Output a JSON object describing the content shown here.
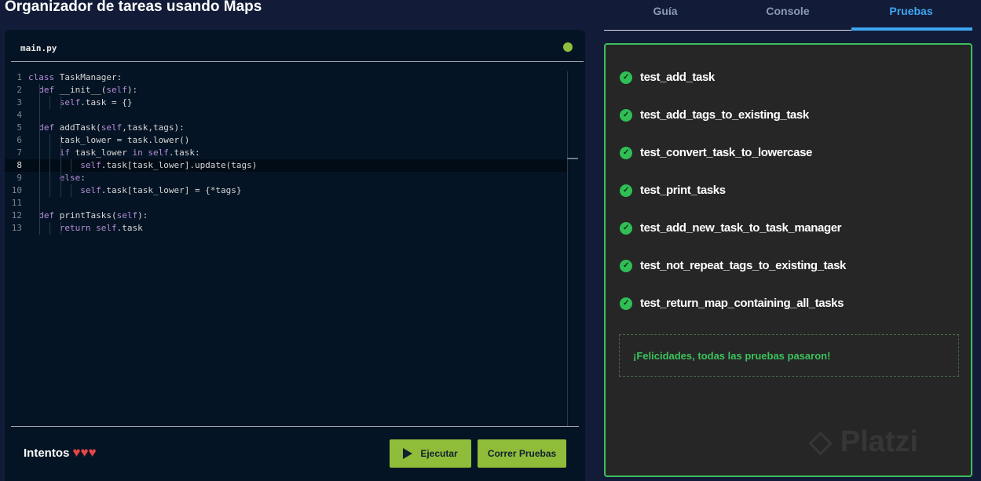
{
  "title": "Organizador de tareas usando Maps",
  "editor": {
    "filename": "main.py",
    "lines": [
      {
        "n": "1",
        "indent": 0,
        "tokens": [
          [
            "kw",
            "class "
          ],
          [
            "t",
            "TaskManager:"
          ]
        ]
      },
      {
        "n": "2",
        "indent": 1,
        "tokens": [
          [
            "kw",
            "def "
          ],
          [
            "t",
            "__init__("
          ],
          [
            "kw",
            "self"
          ],
          [
            "t",
            "):"
          ]
        ]
      },
      {
        "n": "3",
        "indent": 3,
        "tokens": [
          [
            "kw",
            "self"
          ],
          [
            "t",
            ".task = {}"
          ]
        ]
      },
      {
        "n": "4",
        "indent": 0,
        "tokens": []
      },
      {
        "n": "5",
        "indent": 1,
        "tokens": [
          [
            "kw",
            "def "
          ],
          [
            "t",
            "addTask("
          ],
          [
            "kw",
            "self"
          ],
          [
            "t",
            ",task,tags):"
          ]
        ]
      },
      {
        "n": "6",
        "indent": 3,
        "tokens": [
          [
            "t",
            "task_lower = task.lower()"
          ]
        ]
      },
      {
        "n": "7",
        "indent": 3,
        "tokens": [
          [
            "kw",
            "if "
          ],
          [
            "t",
            "task_lower "
          ],
          [
            "kw",
            "in self"
          ],
          [
            "t",
            ".task:"
          ]
        ]
      },
      {
        "n": "8",
        "indent": 5,
        "active": true,
        "tokens": [
          [
            "kw",
            "self"
          ],
          [
            "t",
            ".task[task_lower].update(tags)"
          ]
        ]
      },
      {
        "n": "9",
        "indent": 3,
        "tokens": [
          [
            "kw",
            "else"
          ],
          [
            "t",
            ":"
          ]
        ]
      },
      {
        "n": "10",
        "indent": 5,
        "tokens": [
          [
            "kw",
            "self"
          ],
          [
            "t",
            ".task[task_lower] = {*tags}"
          ]
        ]
      },
      {
        "n": "11",
        "indent": 0,
        "tokens": []
      },
      {
        "n": "12",
        "indent": 1,
        "tokens": [
          [
            "kw",
            "def "
          ],
          [
            "t",
            "printTasks("
          ],
          [
            "kw",
            "self"
          ],
          [
            "t",
            "):"
          ]
        ]
      },
      {
        "n": "13",
        "indent": 3,
        "tokens": [
          [
            "kw",
            "return self"
          ],
          [
            "t",
            ".task"
          ]
        ]
      }
    ]
  },
  "footer": {
    "intentos_label": "Intentos",
    "hearts": 3,
    "run_label": "Ejecutar",
    "tests_label": "Correr Pruebas"
  },
  "tabs": [
    {
      "label": "Guía"
    },
    {
      "label": "Console"
    },
    {
      "label": "Pruebas",
      "active": true
    }
  ],
  "tests": [
    "test_add_task",
    "test_add_tags_to_existing_task",
    "test_convert_task_to_lowercase",
    "test_print_tasks",
    "test_add_new_task_to_task_manager",
    "test_not_repeat_tags_to_existing_task",
    "test_return_map_containing_all_tasks"
  ],
  "success_message": "¡Felicidades, todas las pruebas pasaron!",
  "watermark": "Platzi"
}
